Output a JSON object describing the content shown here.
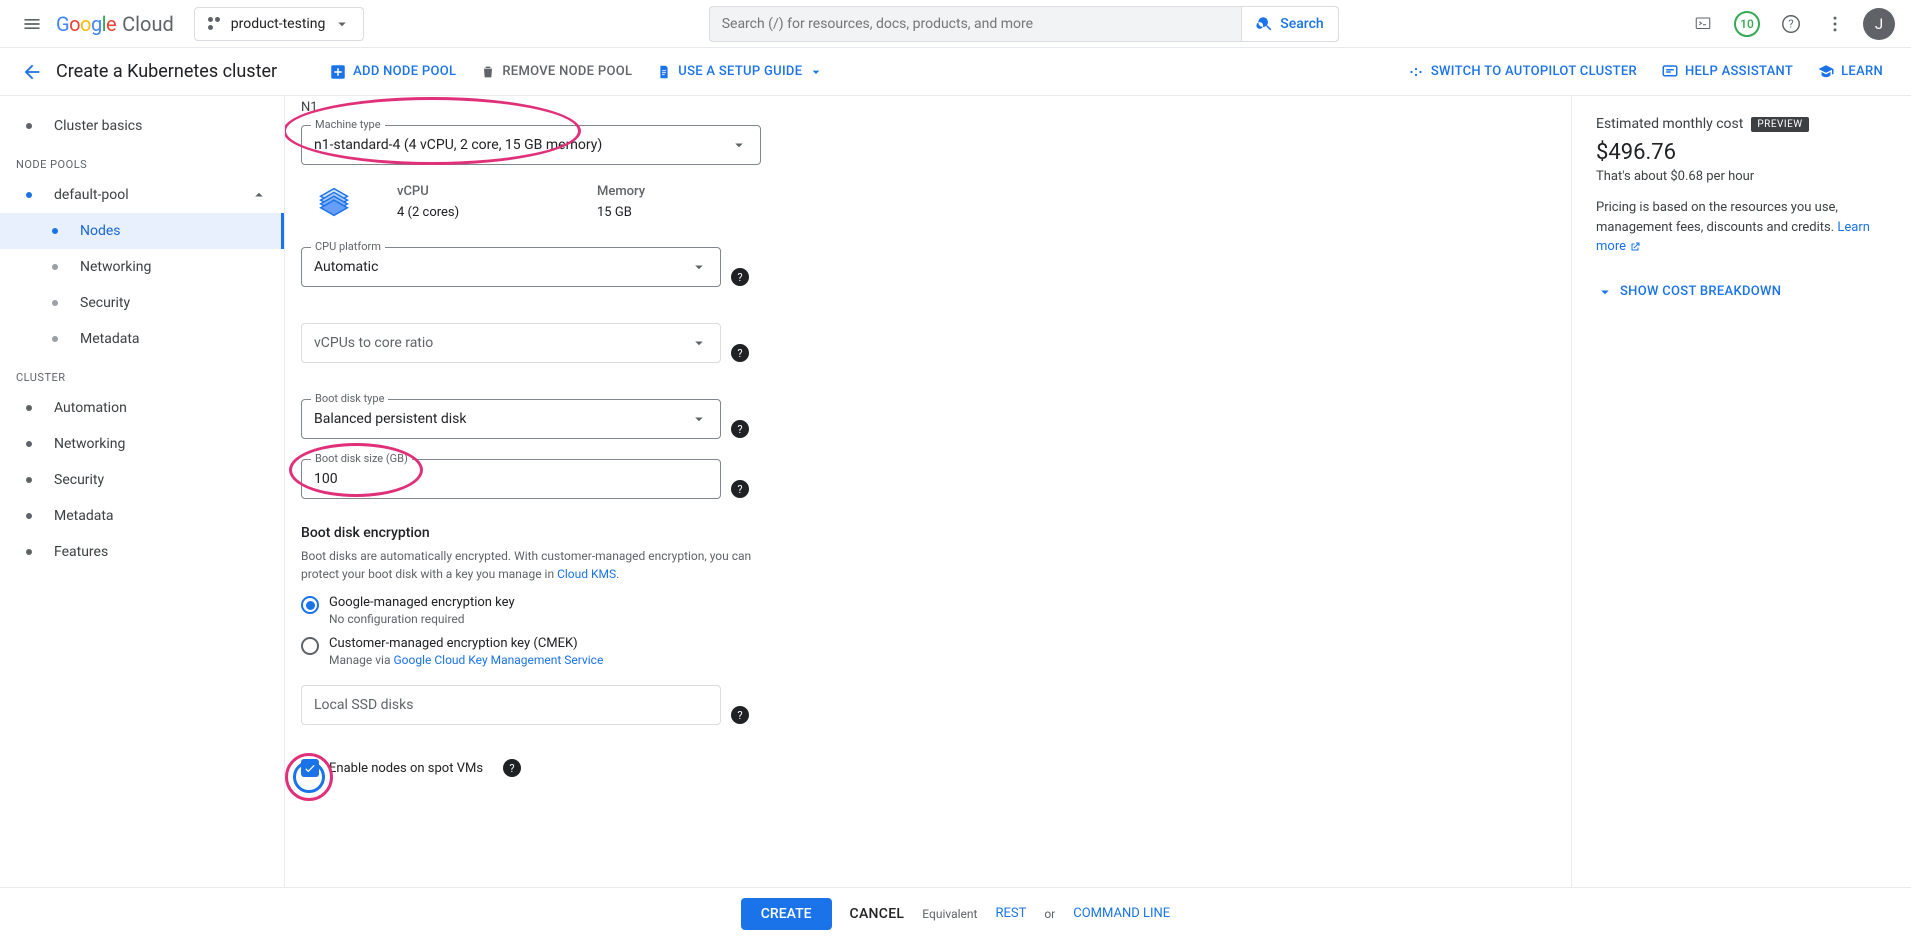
{
  "header": {
    "logo_cloud": "Cloud",
    "project": "product-testing",
    "search_placeholder": "Search (/) for resources, docs, products, and more",
    "search_btn": "Search",
    "trial_count": "10",
    "avatar_initial": "J"
  },
  "actionbar": {
    "page_title": "Create a Kubernetes cluster",
    "add_node_pool": "ADD NODE POOL",
    "remove_node_pool": "REMOVE NODE POOL",
    "setup_guide": "USE A SETUP GUIDE",
    "switch_autopilot": "SWITCH TO AUTOPILOT CLUSTER",
    "help_assistant": "HELP ASSISTANT",
    "learn": "LEARN"
  },
  "sidebar": {
    "cluster_basics": "Cluster basics",
    "node_pools_label": "NODE POOLS",
    "default_pool": "default-pool",
    "nodes": "Nodes",
    "networking": "Networking",
    "security": "Security",
    "metadata": "Metadata",
    "cluster_label": "CLUSTER",
    "automation": "Automation",
    "networking2": "Networking",
    "security2": "Security",
    "metadata2": "Metadata",
    "features": "Features"
  },
  "form": {
    "series": "N1",
    "machine_type_label": "Machine type",
    "machine_type_value": "n1-standard-4 (4 vCPU, 2 core, 15 GB memory)",
    "vcpu_h": "vCPU",
    "vcpu_v": "4 (2 cores)",
    "memory_h": "Memory",
    "memory_v": "15 GB",
    "cpu_platform_label": "CPU platform",
    "cpu_platform_value": "Automatic",
    "vcpu_ratio_label": "vCPUs to core ratio",
    "boot_disk_type_label": "Boot disk type",
    "boot_disk_type_value": "Balanced persistent disk",
    "boot_disk_size_label": "Boot disk size (GB)",
    "boot_disk_size_value": "100",
    "encryption_heading": "Boot disk encryption",
    "encryption_desc": "Boot disks are automatically encrypted. With customer-managed encryption, you can protect your boot disk with a key you manage in ",
    "cloud_kms": "Cloud KMS",
    "radio1_label": "Google-managed encryption key",
    "radio1_sub": "No configuration required",
    "radio2_label": "Customer-managed encryption key (CMEK)",
    "radio2_sub_prefix": "Manage via ",
    "radio2_sub_link": "Google Cloud Key Management Service",
    "local_ssd_label": "Local SSD disks",
    "spot_checkbox": "Enable nodes on spot VMs"
  },
  "cost": {
    "title": "Estimated monthly cost",
    "preview": "PREVIEW",
    "value": "$496.76",
    "per_hour": "That's about $0.68 per hour",
    "pricing_text": "Pricing is based on the resources you use, management fees, discounts and credits. ",
    "learn_more": "Learn more",
    "show_breakdown": "SHOW COST BREAKDOWN"
  },
  "footer": {
    "create": "CREATE",
    "cancel": "CANCEL",
    "equivalent": "Equivalent",
    "rest": "REST",
    "or": "or",
    "cli": "COMMAND LINE"
  }
}
